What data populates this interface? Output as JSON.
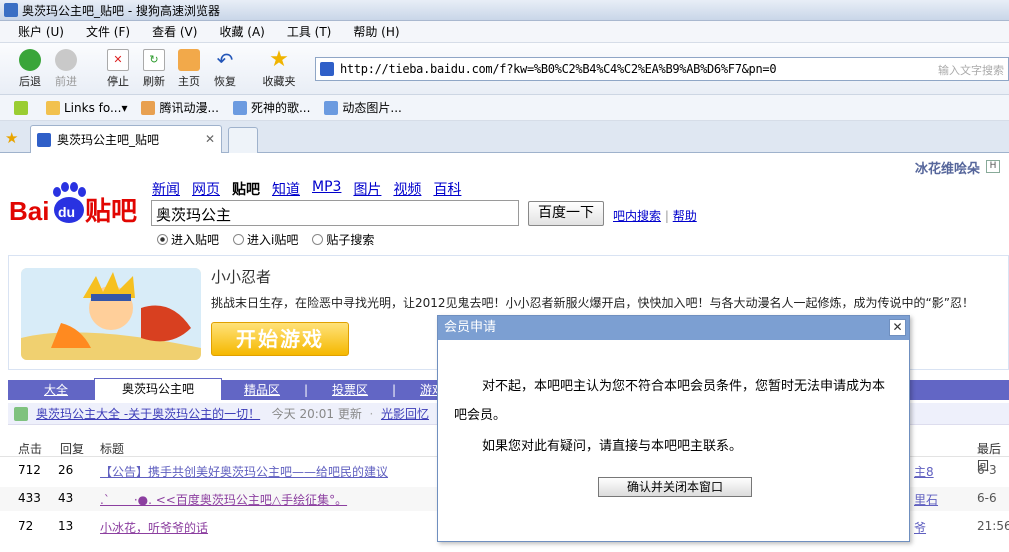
{
  "window": {
    "title": "奥茨玛公主吧_贴吧 - 搜狗高速浏览器"
  },
  "menu": [
    "账户 (U)",
    "文件 (F)",
    "查看 (V)",
    "收藏 (A)",
    "工具 (T)",
    "帮助 (H)"
  ],
  "toolbar": {
    "back": "后退",
    "forward": "前进",
    "stop": "停止",
    "refresh": "刷新",
    "home": "主页",
    "restore": "恢复",
    "favorites": "收藏夹"
  },
  "address": {
    "url": "http://tieba.baidu.com/f?kw=%B0%C2%B4%C4%C2%EA%B9%AB%D6%F7&pn=0",
    "search_placeholder": "输入文字搜索"
  },
  "links": [
    "Links fo...",
    "腾讯动漫...",
    "死神的歌...",
    "动态图片..."
  ],
  "tab": {
    "label": "奥茨玛公主吧_贴吧"
  },
  "page": {
    "user": "冰花维哙朵",
    "user_badge": "H",
    "nav": [
      "新闻",
      "网页",
      "贴吧",
      "知道",
      "MP3",
      "图片",
      "视频",
      "百科"
    ],
    "search_value": "奥茨玛公主",
    "search_button": "百度一下",
    "search_in_bar": "吧内搜索",
    "help": "帮助",
    "radios": [
      "进入贴吧",
      "进入i贴吧",
      "贴子搜索"
    ],
    "ad": {
      "title": "小小忍者",
      "desc": "挑战末日生存，在险恶中寻找光明，让2012见鬼去吧！小小忍者新服火爆开启，快快加入吧！与各大动漫名人一起修炼，成为传说中的“影”忍！",
      "button": "开始游戏"
    },
    "forum_tabs": [
      "大全",
      "奥茨玛公主吧",
      "精品区",
      "投票区",
      "游戏"
    ],
    "notice": {
      "link": "奥茨玛公主大全 -关于奥茨玛公主的一切！",
      "time_label": "今天",
      "time": "20:01 更新",
      "more": "光影回忆"
    },
    "columns": [
      "点击",
      "回复",
      "标题",
      "最后回"
    ],
    "rows": [
      {
        "clicks": "712",
        "replies": "26",
        "title": "【公告】携手共创美好奥茨玛公主吧——给吧民的建议",
        "author": "主8",
        "time": "6-3"
      },
      {
        "clicks": "433",
        "replies": "43",
        "title": ".`　　·●. <<百度奥茨玛公主吧△手绘征集°。",
        "author": "里石",
        "time": "6-6"
      },
      {
        "clicks": "72",
        "replies": "13",
        "title": "小冰花，听爷爷的话",
        "author": "爷",
        "time": "21:56"
      }
    ]
  },
  "dialog": {
    "title": "会员申请",
    "line1": "对不起，本吧吧主认为您不符合本吧会员条件，您暂时无法申请成为本吧会员。",
    "line2": "如果您对此有疑问，请直接与本吧吧主联系。",
    "button": "确认并关闭本窗口"
  }
}
